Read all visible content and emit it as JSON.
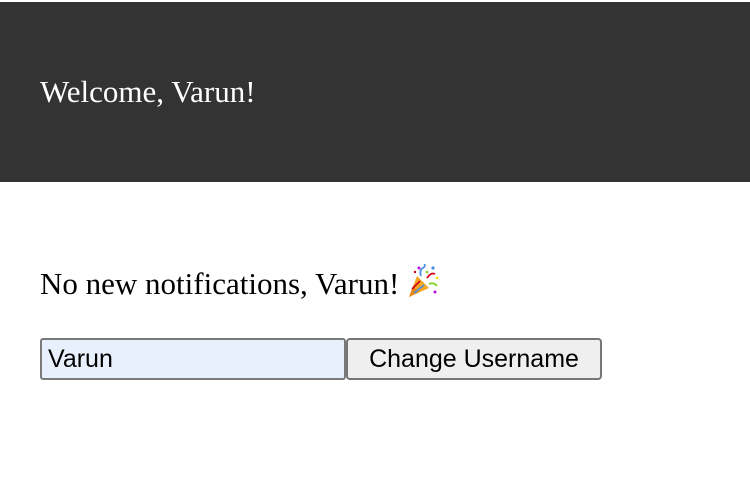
{
  "header": {
    "welcome_text": "Welcome, Varun!",
    "background_color": "#333333"
  },
  "notifications": {
    "message": "No new notifications, Varun!",
    "icon": "party-popper-icon"
  },
  "username_form": {
    "input_value": "Varun",
    "button_label": "Change Username",
    "input_background": "#e8f0fe"
  }
}
